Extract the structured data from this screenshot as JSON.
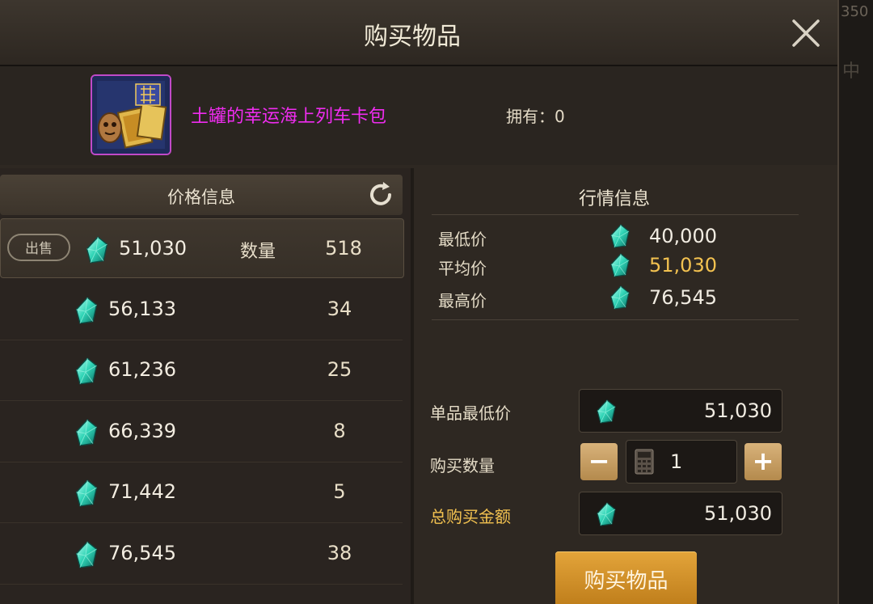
{
  "modal": {
    "title": "购买物品"
  },
  "background": {
    "hint": "350",
    "side_icon": "中"
  },
  "item": {
    "name": "土罐的幸运海上列车卡包",
    "owned": "拥有：0"
  },
  "price_panel": {
    "title": "价格信息",
    "sell_label": "出售",
    "qty_label": "数量",
    "rows": [
      {
        "price": "51,030",
        "qty": "518"
      },
      {
        "price": "56,133",
        "qty": "34"
      },
      {
        "price": "61,236",
        "qty": "25"
      },
      {
        "price": "66,339",
        "qty": "8"
      },
      {
        "price": "71,442",
        "qty": "5"
      },
      {
        "price": "76,545",
        "qty": "38"
      }
    ]
  },
  "market": {
    "title": "行情信息",
    "lowest_label": "最低价",
    "lowest_value": "40,000",
    "average_label": "平均价",
    "average_value": "51,030",
    "highest_label": "最高价",
    "highest_value": "76,545"
  },
  "form": {
    "unit_min_label": "单品最低价",
    "unit_min_value": "51,030",
    "qty_label": "购买数量",
    "qty_value": "1",
    "total_label": "总购买金额",
    "total_value": "51,030",
    "minus": "−",
    "plus": "+"
  },
  "buy_button": "购买物品",
  "colors": {
    "accent_gold": "#f3c250",
    "item_name": "#f02cf0",
    "gem": "#2fd3b5",
    "button": "#d4922a"
  },
  "icons": [
    "close-icon",
    "refresh-icon",
    "gem-icon",
    "calculator-icon",
    "minus-icon",
    "plus-icon"
  ]
}
